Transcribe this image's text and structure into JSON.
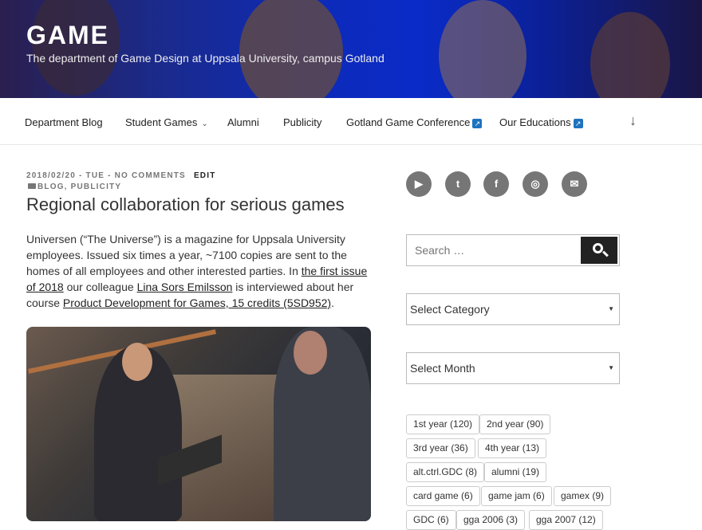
{
  "header": {
    "title": "GAME",
    "description": "The department of Game Design at Uppsala University, campus Gotland"
  },
  "nav": {
    "items": [
      {
        "label": "Department Blog"
      },
      {
        "label": "Student Games",
        "has_dropdown": true
      },
      {
        "label": "Alumni"
      },
      {
        "label": "Publicity"
      },
      {
        "label": "Gotland Game Conference",
        "external": true
      },
      {
        "label": "Our Educations",
        "external": true
      }
    ],
    "scroll_icon": "arrow-down-icon"
  },
  "post": {
    "meta": "2018/02/20 - TUE - NO COMMENTS",
    "edit_label": "EDIT",
    "categories": "BLOG, PUBLICITY",
    "title": "Regional collaboration for serious games",
    "body": {
      "p1": "Universen (“The Universe”) is a magazine for Uppsala University employees. Issued six times a year, ~7100 copies are sent to the homes of all employees and other interested parties. In ",
      "link1": "the first issue of 2018",
      "p2": " our colleague ",
      "link2": "Lina Sors Emilsson",
      "p3": " is interviewed about her course ",
      "link3": "Product Development for Games, 15 credits (5SD952)",
      "p4": "."
    }
  },
  "sidebar": {
    "social": [
      {
        "icon": "youtube-icon",
        "glyph": "▶"
      },
      {
        "icon": "twitter-icon",
        "glyph": "t"
      },
      {
        "icon": "facebook-icon",
        "glyph": "f"
      },
      {
        "icon": "instagram-icon",
        "glyph": "◎"
      },
      {
        "icon": "email-icon",
        "glyph": "✉"
      }
    ],
    "search_placeholder": "Search …",
    "category_select": "Select Category",
    "month_select": "Select Month",
    "tags": [
      "1st year (120)",
      "2nd year (90)",
      "3rd year (36)",
      "4th year (13)",
      "alt.ctrl.GDC (8)",
      "alumni (19)",
      "card game (6)",
      "game jam (6)",
      "gamex (9)",
      "GDC (6)",
      "gga 2006 (3)",
      "gga 2007 (12)"
    ]
  },
  "colors": {
    "accent_link": "#222222",
    "header_blue": "#0a2bc8",
    "external_badge": "#1e73be"
  }
}
